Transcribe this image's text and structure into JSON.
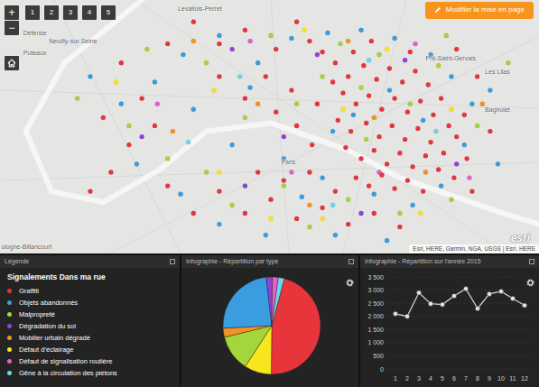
{
  "toolbar": {
    "zoom_in": "+",
    "zoom_out": "−",
    "bookmarks": [
      "1",
      "2",
      "3",
      "4",
      "5"
    ],
    "edit_button": "Modifier la mise en page"
  },
  "map": {
    "places": [
      {
        "label": "Levallois-Perret",
        "lon": 2.284,
        "lat": 48.906
      },
      {
        "label": "Neuilly-sur-Seine",
        "lon": 2.234,
        "lat": 48.894
      },
      {
        "label": "Défense",
        "lon": 2.224,
        "lat": 48.897
      },
      {
        "label": "Puteaux",
        "lon": 2.224,
        "lat": 48.89
      },
      {
        "label": "Paris",
        "lon": 2.324,
        "lat": 48.85
      },
      {
        "label": "Pré-Saint-Gervais",
        "lon": 2.38,
        "lat": 48.888
      },
      {
        "label": "Les Lilas",
        "lon": 2.403,
        "lat": 48.883
      },
      {
        "label": "Bagnolet",
        "lon": 2.403,
        "lat": 48.869
      },
      {
        "label": "ulogne-Billancourt",
        "lon": 2.2155,
        "lat": 48.819
      }
    ],
    "attribution": "Esri, HERE, Garmin, NGA, USGS | Esri, HERE",
    "logo": "esri"
  },
  "legend": {
    "title": "Légende",
    "heading": "Signalements Dans ma rue",
    "items": [
      {
        "label": "Graffiti",
        "color": "#e8353b",
        "points": [
          [
            2.345,
            48.885
          ],
          [
            2.35,
            48.88
          ],
          [
            2.356,
            48.884
          ],
          [
            2.361,
            48.879
          ],
          [
            2.366,
            48.883
          ],
          [
            2.371,
            48.878
          ],
          [
            2.376,
            48.882
          ],
          [
            2.381,
            48.877
          ],
          [
            2.386,
            48.872
          ],
          [
            2.348,
            48.874
          ],
          [
            2.353,
            48.87
          ],
          [
            2.358,
            48.873
          ],
          [
            2.363,
            48.868
          ],
          [
            2.368,
            48.872
          ],
          [
            2.373,
            48.867
          ],
          [
            2.378,
            48.871
          ],
          [
            2.383,
            48.866
          ],
          [
            2.389,
            48.862
          ],
          [
            2.346,
            48.864
          ],
          [
            2.351,
            48.86
          ],
          [
            2.357,
            48.863
          ],
          [
            2.362,
            48.858
          ],
          [
            2.367,
            48.862
          ],
          [
            2.372,
            48.857
          ],
          [
            2.377,
            48.861
          ],
          [
            2.382,
            48.856
          ],
          [
            2.387,
            48.852
          ],
          [
            2.392,
            48.858
          ],
          [
            2.349,
            48.854
          ],
          [
            2.355,
            48.85
          ],
          [
            2.36,
            48.853
          ],
          [
            2.365,
            48.848
          ],
          [
            2.37,
            48.852
          ],
          [
            2.375,
            48.847
          ],
          [
            2.38,
            48.851
          ],
          [
            2.385,
            48.846
          ],
          [
            2.391,
            48.843
          ],
          [
            2.353,
            48.843
          ],
          [
            2.358,
            48.84
          ],
          [
            2.363,
            48.844
          ],
          [
            2.368,
            48.839
          ],
          [
            2.373,
            48.842
          ],
          [
            2.34,
            48.889
          ],
          [
            2.344,
            48.878
          ],
          [
            2.352,
            48.889
          ],
          [
            2.374,
            48.889
          ],
          [
            2.395,
            48.866
          ],
          [
            2.396,
            48.85
          ],
          [
            2.379,
            48.838
          ],
          [
            2.359,
            48.893
          ],
          [
            2.3,
            48.892
          ],
          [
            2.31,
            48.897
          ],
          [
            2.322,
            48.89
          ],
          [
            2.33,
            48.9
          ],
          [
            2.335,
            48.893
          ],
          [
            2.29,
            48.9
          ],
          [
            2.28,
            48.892
          ],
          [
            2.318,
            48.88
          ],
          [
            2.328,
            48.875
          ],
          [
            2.338,
            48.87
          ],
          [
            2.33,
            48.862
          ],
          [
            2.336,
            48.855
          ],
          [
            2.322,
            48.867
          ],
          [
            2.31,
            48.872
          ],
          [
            2.3,
            48.88
          ],
          [
            2.262,
            48.885
          ],
          [
            2.27,
            48.872
          ],
          [
            2.255,
            48.865
          ],
          [
            2.265,
            48.855
          ],
          [
            2.258,
            48.845
          ],
          [
            2.25,
            48.838
          ],
          [
            2.275,
            48.862
          ],
          [
            2.3,
            48.838
          ],
          [
            2.31,
            48.83
          ],
          [
            2.32,
            48.835
          ],
          [
            2.33,
            48.828
          ],
          [
            2.34,
            48.832
          ],
          [
            2.35,
            48.826
          ],
          [
            2.36,
            48.83
          ],
          [
            2.37,
            48.825
          ],
          [
            2.29,
            48.83
          ],
          [
            2.28,
            48.84
          ],
          [
            2.315,
            48.845
          ],
          [
            2.325,
            48.842
          ],
          [
            2.345,
            48.838
          ],
          [
            2.335,
            48.845
          ],
          [
            2.4,
            48.88
          ],
          [
            2.405,
            48.86
          ],
          [
            2.398,
            48.838
          ],
          [
            2.392,
            48.89
          ]
        ]
      },
      {
        "label": "Objets abandonnés",
        "color": "#3a9de0",
        "points": [
          [
            2.3,
            48.895
          ],
          [
            2.315,
            48.885
          ],
          [
            2.328,
            48.894
          ],
          [
            2.342,
            48.896
          ],
          [
            2.355,
            48.897
          ],
          [
            2.368,
            48.894
          ],
          [
            2.382,
            48.888
          ],
          [
            2.39,
            48.88
          ],
          [
            2.398,
            48.87
          ],
          [
            2.395,
            48.855
          ],
          [
            2.386,
            48.84
          ],
          [
            2.375,
            48.833
          ],
          [
            2.36,
            48.837
          ],
          [
            2.34,
            48.843
          ],
          [
            2.325,
            48.85
          ],
          [
            2.305,
            48.855
          ],
          [
            2.29,
            48.868
          ],
          [
            2.275,
            48.878
          ],
          [
            2.262,
            48.87
          ],
          [
            2.268,
            48.848
          ],
          [
            2.285,
            48.837
          ],
          [
            2.3,
            48.826
          ],
          [
            2.318,
            48.822
          ],
          [
            2.345,
            48.822
          ],
          [
            2.365,
            48.82
          ],
          [
            2.352,
            48.866
          ],
          [
            2.366,
            48.875
          ],
          [
            2.379,
            48.864
          ],
          [
            2.344,
            48.86
          ],
          [
            2.312,
            48.876
          ],
          [
            2.286,
            48.888
          ],
          [
            2.405,
            48.875
          ],
          [
            2.408,
            48.848
          ],
          [
            2.25,
            48.88
          ],
          [
            2.332,
            48.836
          ]
        ]
      },
      {
        "label": "Malpropreté",
        "color": "#a4d53a",
        "points": [
          [
            2.295,
            48.885
          ],
          [
            2.32,
            48.895
          ],
          [
            2.347,
            48.892
          ],
          [
            2.362,
            48.888
          ],
          [
            2.385,
            48.884
          ],
          [
            2.4,
            48.862
          ],
          [
            2.39,
            48.835
          ],
          [
            2.37,
            48.83
          ],
          [
            2.335,
            48.825
          ],
          [
            2.305,
            48.833
          ],
          [
            2.28,
            48.85
          ],
          [
            2.265,
            48.862
          ],
          [
            2.272,
            48.89
          ],
          [
            2.31,
            48.865
          ],
          [
            2.33,
            48.87
          ],
          [
            2.357,
            48.857
          ],
          [
            2.374,
            48.87
          ],
          [
            2.35,
            48.835
          ],
          [
            2.325,
            48.84
          ],
          [
            2.295,
            48.845
          ],
          [
            2.245,
            48.872
          ],
          [
            2.412,
            48.885
          ],
          [
            2.388,
            48.895
          ],
          [
            2.34,
            48.88
          ],
          [
            2.355,
            48.876
          ]
        ]
      },
      {
        "label": "Dégradation du sol",
        "color": "#8e44d6",
        "points": [
          [
            2.305,
            48.89
          ],
          [
            2.338,
            48.888
          ],
          [
            2.372,
            48.886
          ],
          [
            2.392,
            48.848
          ],
          [
            2.355,
            48.83
          ],
          [
            2.31,
            48.84
          ],
          [
            2.27,
            48.858
          ],
          [
            2.325,
            48.858
          ]
        ]
      },
      {
        "label": "Mobilier urbain dégradé",
        "color": "#f39322",
        "points": [
          [
            2.29,
            48.893
          ],
          [
            2.35,
            48.893
          ],
          [
            2.38,
            48.845
          ],
          [
            2.402,
            48.87
          ],
          [
            2.335,
            48.833
          ],
          [
            2.282,
            48.86
          ],
          [
            2.315,
            48.87
          ],
          [
            2.36,
            48.865
          ]
        ]
      },
      {
        "label": "Défaut d’éclairage",
        "color": "#f7e61e",
        "points": [
          [
            2.298,
            48.875
          ],
          [
            2.333,
            48.897
          ],
          [
            2.365,
            48.89
          ],
          [
            2.39,
            48.868
          ],
          [
            2.378,
            48.83
          ],
          [
            2.34,
            48.828
          ],
          [
            2.3,
            48.845
          ],
          [
            2.26,
            48.878
          ],
          [
            2.348,
            48.868
          ],
          [
            2.32,
            48.828
          ]
        ]
      },
      {
        "label": "Défaut de signalisation routière",
        "color": "#e55fd0",
        "points": [
          [
            2.312,
            48.893
          ],
          [
            2.376,
            48.892
          ],
          [
            2.397,
            48.843
          ],
          [
            2.328,
            48.845
          ],
          [
            2.276,
            48.87
          ],
          [
            2.362,
            48.845
          ]
        ]
      },
      {
        "label": "Gêne à la circulation des piétons",
        "color": "#6fd5e8",
        "points": [
          [
            2.308,
            48.88
          ],
          [
            2.358,
            48.886
          ],
          [
            2.384,
            48.86
          ],
          [
            2.344,
            48.833
          ],
          [
            2.288,
            48.856
          ]
        ]
      }
    ]
  },
  "pie": {
    "title": "Infographie - Répartition par type",
    "values": [
      46,
      24,
      12,
      2,
      3,
      9,
      2,
      2
    ]
  },
  "line_chart": {
    "title": "Infographie - Répartition sur l'année 2015",
    "y_ticks": [
      "0",
      "500",
      "1 000",
      "1 500",
      "2 000",
      "2 500",
      "3 000",
      "3 500"
    ],
    "x_ticks": [
      "1",
      "2",
      "3",
      "4",
      "5",
      "6",
      "7",
      "8",
      "9",
      "10",
      "11",
      "12"
    ],
    "values": [
      2100,
      2000,
      2900,
      2480,
      2450,
      2780,
      3050,
      2300,
      2850,
      2950,
      2680,
      2420
    ]
  }
}
